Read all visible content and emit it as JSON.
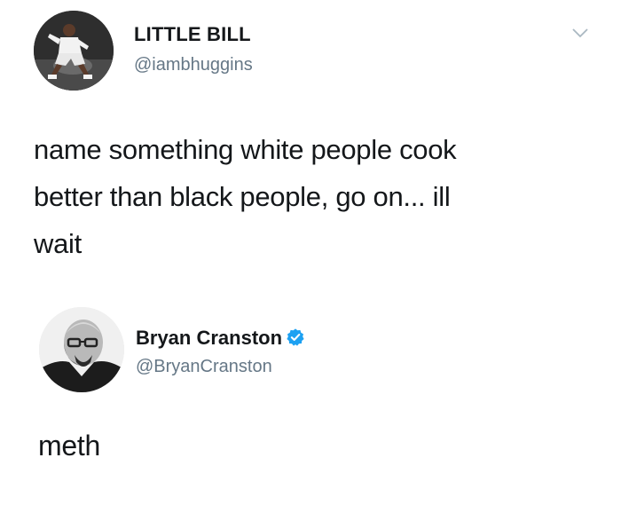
{
  "tweets": [
    {
      "display_name": "LITTLE BILL",
      "handle": "@iambhuggins",
      "avatar_icon": "person-dancing-photo",
      "text_lines": [
        "name something white people cook",
        "better than black people, go on... ill",
        "wait"
      ]
    },
    {
      "display_name": "Bryan Cranston",
      "handle": "@BryanCranston",
      "verified": true,
      "verified_color": "#1da1f2",
      "avatar_icon": "bald-man-goatee-photo",
      "text_lines": [
        "meth"
      ]
    }
  ],
  "menu_icon": "chevron-down-icon"
}
